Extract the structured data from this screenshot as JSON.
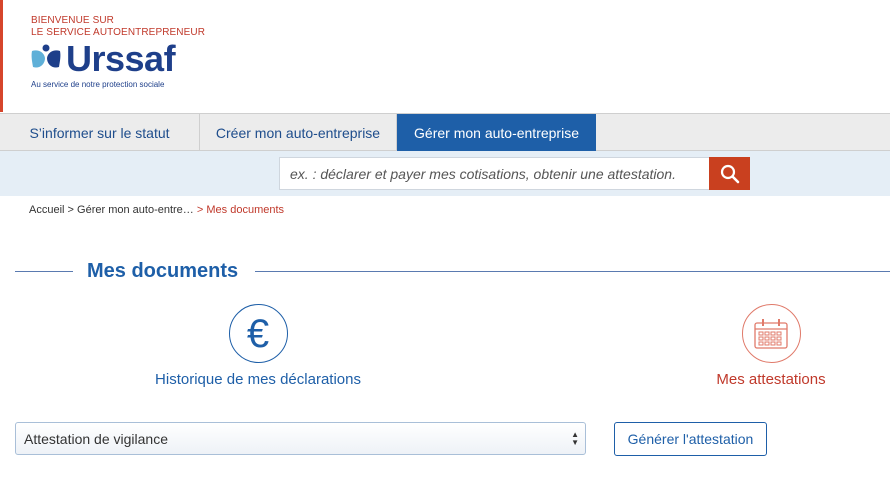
{
  "header": {
    "welcome_line1": "BIENVENUE SUR",
    "welcome_line2": "LE SERVICE AUTOENTREPRENEUR",
    "logo_text": "Urssaf",
    "tagline": "Au service de notre protection sociale"
  },
  "nav": {
    "tabs": [
      {
        "label": "S’informer sur le statut"
      },
      {
        "label": "Créer mon auto-entreprise"
      },
      {
        "label": "Gérer mon auto-entreprise",
        "active": true
      }
    ]
  },
  "search": {
    "placeholder": "ex. : déclarer et payer mes cotisations, obtenir une attestation.",
    "icon": "search-icon"
  },
  "breadcrumb": {
    "home": "Accueil",
    "parent": "Gérer mon auto-entre…",
    "current": "Mes documents",
    "separator": ">"
  },
  "main": {
    "title": "Mes documents",
    "cards": [
      {
        "label": "Historique de mes déclarations",
        "icon": "euro-icon",
        "glyph": "€"
      },
      {
        "label": "Mes attestations",
        "icon": "calendar-icon"
      }
    ],
    "attestation_select": {
      "value": "Attestation de vigilance"
    },
    "generate_button": "Générer l'attestation"
  },
  "colors": {
    "brand_blue": "#1e5fa8",
    "brand_red": "#c0392b",
    "search_button": "#c9401f",
    "nav_background": "#ececec",
    "search_band": "#e5eef6"
  }
}
